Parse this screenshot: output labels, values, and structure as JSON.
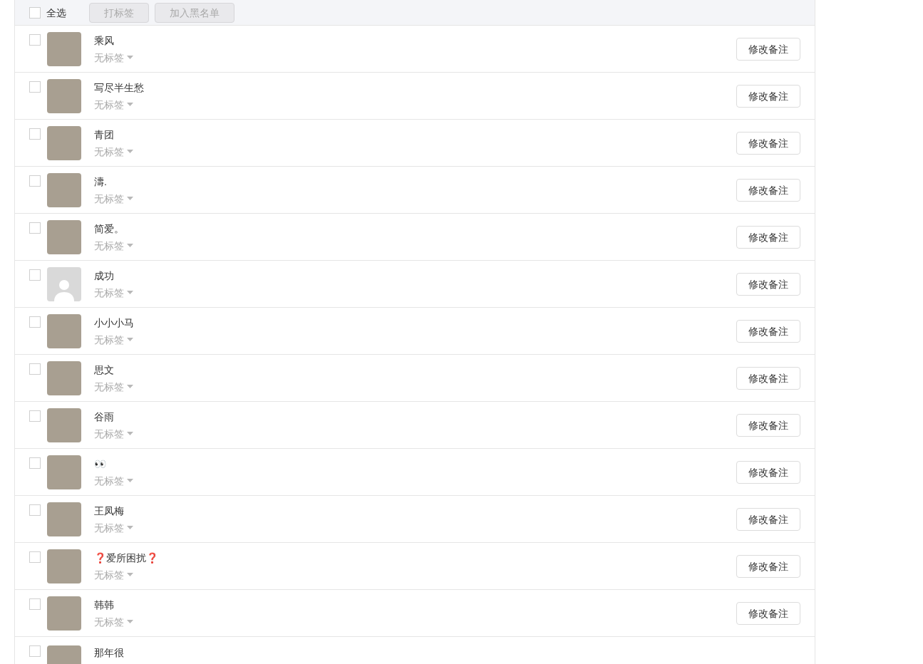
{
  "toolbar": {
    "select_all": {
      "label": "全选",
      "checked": false
    },
    "buttons": [
      {
        "label": "打标签",
        "disabled": true
      },
      {
        "label": "加入黑名单",
        "disabled": true
      }
    ]
  },
  "contacts": [
    {
      "name": "乘风",
      "tag": "无标签",
      "kind": "photo",
      "checked": false,
      "action": "修改备注"
    },
    {
      "name": "写尽半生愁",
      "tag": "无标签",
      "kind": "photo",
      "checked": false,
      "action": "修改备注"
    },
    {
      "name": "青团",
      "tag": "无标签",
      "kind": "photo",
      "checked": false,
      "action": "修改备注"
    },
    {
      "name": "濤.",
      "tag": "无标签",
      "kind": "photo",
      "checked": false,
      "action": "修改备注"
    },
    {
      "name": "简爱。",
      "tag": "无标签",
      "kind": "photo",
      "checked": false,
      "action": "修改备注"
    },
    {
      "name": "成功",
      "tag": "无标签",
      "kind": "default",
      "checked": false,
      "action": "修改备注"
    },
    {
      "name": "小小小马",
      "tag": "无标签",
      "kind": "photo",
      "checked": false,
      "action": "修改备注"
    },
    {
      "name": "思文",
      "tag": "无标签",
      "kind": "photo",
      "checked": false,
      "action": "修改备注"
    },
    {
      "name": "谷雨",
      "tag": "无标签",
      "kind": "photo",
      "checked": false,
      "action": "修改备注"
    },
    {
      "name": "👀",
      "tag": "无标签",
      "kind": "photo",
      "checked": false,
      "action": "修改备注"
    },
    {
      "name": "王凤梅",
      "tag": "无标签",
      "kind": "photo",
      "checked": false,
      "action": "修改备注"
    },
    {
      "name": "❓爱所困扰❓",
      "tag": "无标签",
      "kind": "photo",
      "checked": false,
      "action": "修改备注"
    },
    {
      "name": "韩韩",
      "tag": "无标签",
      "kind": "photo",
      "checked": false,
      "action": "修改备注"
    }
  ],
  "partial_contact": {
    "name": "那年很",
    "kind": "photo",
    "checked": false
  }
}
